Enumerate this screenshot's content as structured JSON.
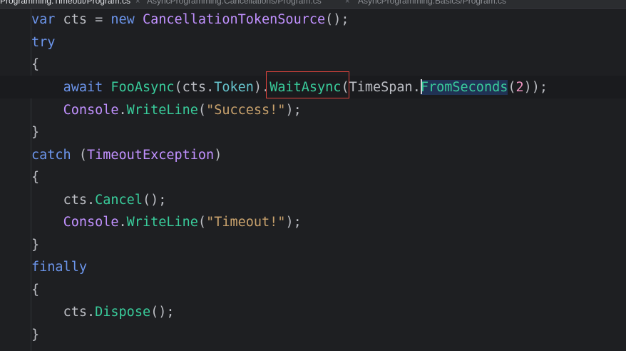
{
  "tabs": [
    {
      "label": "Programming.Timeout/Program.cs",
      "active": true
    },
    {
      "label": "AsyncProgramming.Cancellations/Program.cs",
      "active": false
    },
    {
      "label": "AsyncProgramming.Basics/Program.cs",
      "active": false
    }
  ],
  "code": {
    "l1": {
      "kw_var": "var",
      "id": " cts = ",
      "kw_new": "new",
      "sp": " ",
      "type": "CancellationTokenSource",
      "tail": "();"
    },
    "l2": {
      "kw": "try"
    },
    "l3": {
      "text": "{"
    },
    "l4": {
      "indent": "    ",
      "kw_await": "await",
      "sp": " ",
      "method1": "FooAsync",
      "p1": "(cts.",
      "prop": "Token",
      "p2": ").",
      "method2": "WaitAsync",
      "p3": "(TimeSpan.",
      "method3a": "F",
      "method3b": "romSeconds",
      "p4": "(",
      "num": "2",
      "p5": "));"
    },
    "l5": {
      "indent": "    ",
      "type": "Console",
      "dot": ".",
      "method": "WriteLine",
      "p1": "(",
      "str": "\"Success!\"",
      "p2": ");"
    },
    "l6": {
      "text": "}"
    },
    "l7": {
      "kw": "catch",
      "p1": " (",
      "type": "TimeoutException",
      "p2": ")"
    },
    "l8": {
      "text": "{"
    },
    "l9": {
      "indent": "    ",
      "id": "cts.",
      "method": "Cancel",
      "tail": "();"
    },
    "l10": {
      "indent": "    ",
      "type": "Console",
      "dot": ".",
      "method": "WriteLine",
      "p1": "(",
      "str": "\"Timeout!\"",
      "p2": ");"
    },
    "l11": {
      "text": "}"
    },
    "l12": {
      "kw": "finally"
    },
    "l13": {
      "text": "{"
    },
    "l14": {
      "indent": "    ",
      "id": "cts.",
      "method": "Dispose",
      "tail": "();"
    },
    "l15": {
      "text": "}"
    }
  },
  "highlight": {
    "label": "WaitAsync",
    "color": "#e0453e"
  },
  "colors": {
    "background": "#1e1f22",
    "keyword": "#6c95eb",
    "type": "#c191ff",
    "method": "#39cc9b",
    "string": "#c9a26d",
    "number": "#ed94c0"
  }
}
